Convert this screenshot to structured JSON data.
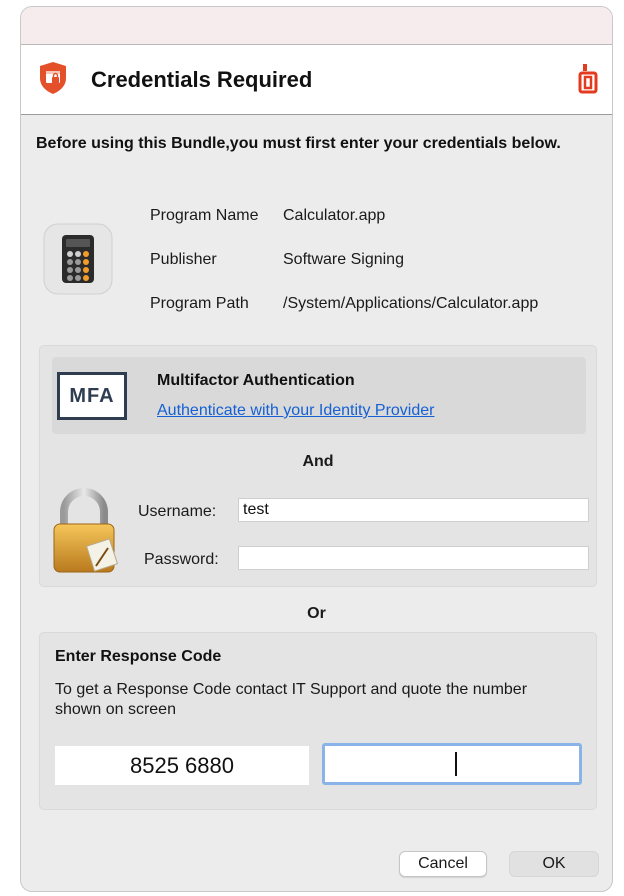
{
  "dialog": {
    "title": "Credentials Required",
    "intro": "Before using this Bundle,you must first enter your credentials below."
  },
  "program": {
    "name_label": "Program Name",
    "name_value": "Calculator.app",
    "publisher_label": "Publisher",
    "publisher_value": "Software Signing",
    "path_label": "Program Path",
    "path_value": "/System/Applications/Calculator.app"
  },
  "mfa": {
    "logo_text": "MFA",
    "title": "Multifactor Authentication",
    "link": "Authenticate with your Identity Provider"
  },
  "and_label": "And",
  "login": {
    "username_label": "Username:",
    "username_value": "test",
    "password_label": "Password:",
    "password_value": ""
  },
  "or_label": "Or",
  "response": {
    "title": "Enter Response Code",
    "description": "To get a Response Code contact IT Support and quote the number shown on screen",
    "challenge_code": "8525 6880",
    "response_value": ""
  },
  "buttons": {
    "cancel": "Cancel",
    "ok": "OK"
  },
  "colors": {
    "shield": "#e4502a",
    "brand": "#e23b20",
    "link": "#1560d4",
    "focus_ring": "#8ab4e8"
  },
  "icons": {
    "header_left": "shield-lock-icon",
    "header_right": "brand-logo-icon",
    "app": "calculator-app-icon",
    "keychain": "padlock-icon"
  }
}
